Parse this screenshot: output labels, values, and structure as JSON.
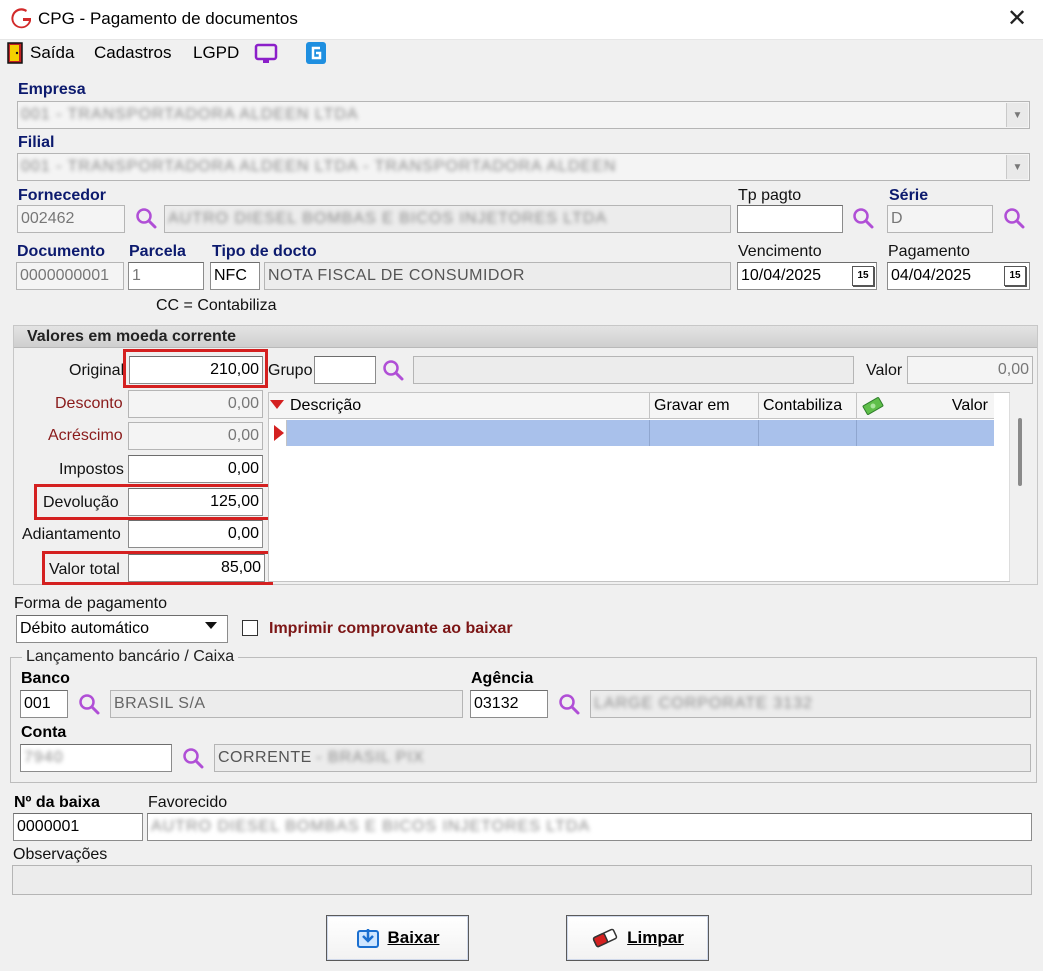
{
  "window": {
    "title": "CPG - Pagamento de documentos"
  },
  "menu": {
    "items": [
      "Saída",
      "Cadastros",
      "LGPD"
    ]
  },
  "empresa": {
    "label": "Empresa",
    "value": "001 - TRANSPORTADORA ALDEEN LTDA"
  },
  "filial": {
    "label": "Filial",
    "value": "001 - TRANSPORTADORA ALDEEN LTDA - TRANSPORTADORA ALDEEN"
  },
  "fornecedor": {
    "label": "Fornecedor",
    "code": "002462",
    "name": "AUTRO DIESEL BOMBAS E BICOS INJETORES LTDA"
  },
  "tp_pagto": {
    "label": "Tp pagto",
    "value": ""
  },
  "serie": {
    "label": "Série",
    "value": "D"
  },
  "documento": {
    "label": "Documento",
    "value": "0000000001"
  },
  "parcela": {
    "label": "Parcela",
    "value": "1"
  },
  "tipo_docto": {
    "label": "Tipo de docto",
    "code": "NFC",
    "name": "NOTA FISCAL DE CONSUMIDOR"
  },
  "vencimento": {
    "label": "Vencimento",
    "value": "10/04/2025"
  },
  "pagamento": {
    "label": "Pagamento",
    "value": "04/04/2025"
  },
  "cc_note": "CC = Contabiliza",
  "valores": {
    "title": "Valores em moeda corrente",
    "original": {
      "label": "Original",
      "value": "210,00"
    },
    "desconto": {
      "label": "Desconto",
      "value": "0,00"
    },
    "acrescimo": {
      "label": "Acréscimo",
      "value": "0,00"
    },
    "impostos": {
      "label": "Impostos",
      "value": "0,00"
    },
    "devolucao": {
      "label": "Devolução",
      "value": "125,00"
    },
    "adiantamento": {
      "label": "Adiantamento",
      "value": "0,00"
    },
    "valor_total": {
      "label": "Valor total",
      "value": "85,00"
    },
    "grupo": {
      "label": "Grupo",
      "value": ""
    },
    "valor": {
      "label": "Valor",
      "value": "0,00"
    },
    "grid_columns": [
      "Descrição",
      "Gravar em",
      "Contabiliza",
      "Valor"
    ]
  },
  "forma_pagamento": {
    "label": "Forma de pagamento",
    "value": "Débito automático"
  },
  "imprimir": {
    "label": "Imprimir comprovante ao baixar",
    "checked": false
  },
  "lancamento": {
    "title": "Lançamento bancário / Caixa",
    "banco": {
      "label": "Banco",
      "code": "001",
      "name": "BRASIL S/A"
    },
    "agencia": {
      "label": "Agência",
      "code": "03132",
      "name": "LARGE CORPORATE 3132"
    },
    "conta": {
      "label": "Conta",
      "code": "7940",
      "type": "CORRENTE",
      "bank": "- BRASIL PIX"
    }
  },
  "baixa": {
    "label": "Nº da baixa",
    "value": "0000001"
  },
  "favorecido": {
    "label": "Favorecido",
    "value": "AUTRO DIESEL BOMBAS E BICOS INJETORES LTDA"
  },
  "observacoes": {
    "label": "Observações",
    "value": ""
  },
  "buttons": {
    "baixar": "Baixar",
    "limpar": "Limpar"
  },
  "colors": {
    "accent_red": "#d42020",
    "label_blue": "#0c1a6e",
    "search_purple": "#b04fd6"
  }
}
